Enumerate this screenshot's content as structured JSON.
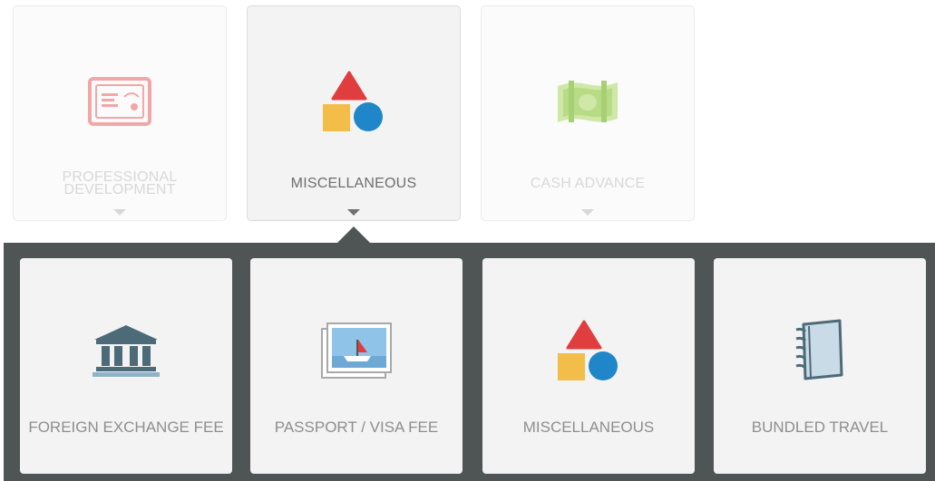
{
  "categories": [
    {
      "label": "PROFESSIONAL DEVELOPMENT",
      "icon": "certificate-icon",
      "selected": false
    },
    {
      "label": "MISCELLANEOUS",
      "icon": "shapes-icon",
      "selected": true
    },
    {
      "label": "CASH ADVANCE",
      "icon": "cash-icon",
      "selected": false
    }
  ],
  "subcategories": [
    {
      "label": "FOREIGN EXCHANGE FEE",
      "icon": "bank-icon"
    },
    {
      "label": "PASSPORT / VISA FEE",
      "icon": "passport-photo-icon"
    },
    {
      "label": "MISCELLANEOUS",
      "icon": "shapes-icon"
    },
    {
      "label": "BUNDLED TRAVEL",
      "icon": "notebook-icon"
    }
  ],
  "colors": {
    "panel": "#4f5555",
    "shape_red": "#e03e3e",
    "shape_yellow": "#f2bd48",
    "shape_blue": "#1f87c9"
  }
}
